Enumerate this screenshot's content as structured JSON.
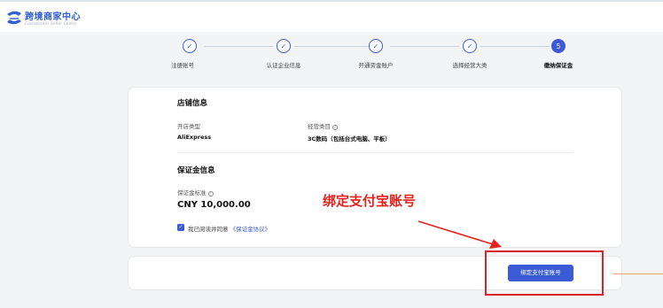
{
  "app": {
    "title": "跨境商家中心",
    "subtitle": "Crossborder Seller Center",
    "logo_icon": "brand-logo"
  },
  "steps": [
    {
      "label": "注册账号",
      "status": "done"
    },
    {
      "label": "认证企业信息",
      "status": "done"
    },
    {
      "label": "开通资金账户",
      "status": "done"
    },
    {
      "label": "选择经营大类",
      "status": "done"
    },
    {
      "label": "缴纳保证金",
      "status": "active",
      "number": "5"
    }
  ],
  "store_info": {
    "title": "店铺信息",
    "shop_type_label": "开店类型",
    "shop_type_value": "AliExpress",
    "category_label": "经营类目",
    "category_value": "3C数码（包括台式电脑、平板）"
  },
  "deposit_info": {
    "title": "保证金信息",
    "standard_label": "保证金标准",
    "amount": "CNY 10,000.00",
    "agreement_prefix": "我已阅读并同意",
    "agreement_link": "《保证金协议》",
    "agreement_checked": true
  },
  "annotation": {
    "text": "绑定支付宝账号"
  },
  "actions": {
    "bind_alipay_label": "绑定支付宝账号"
  },
  "colors": {
    "primary": "#3b5bd6",
    "annotation_red": "#e5221b"
  }
}
